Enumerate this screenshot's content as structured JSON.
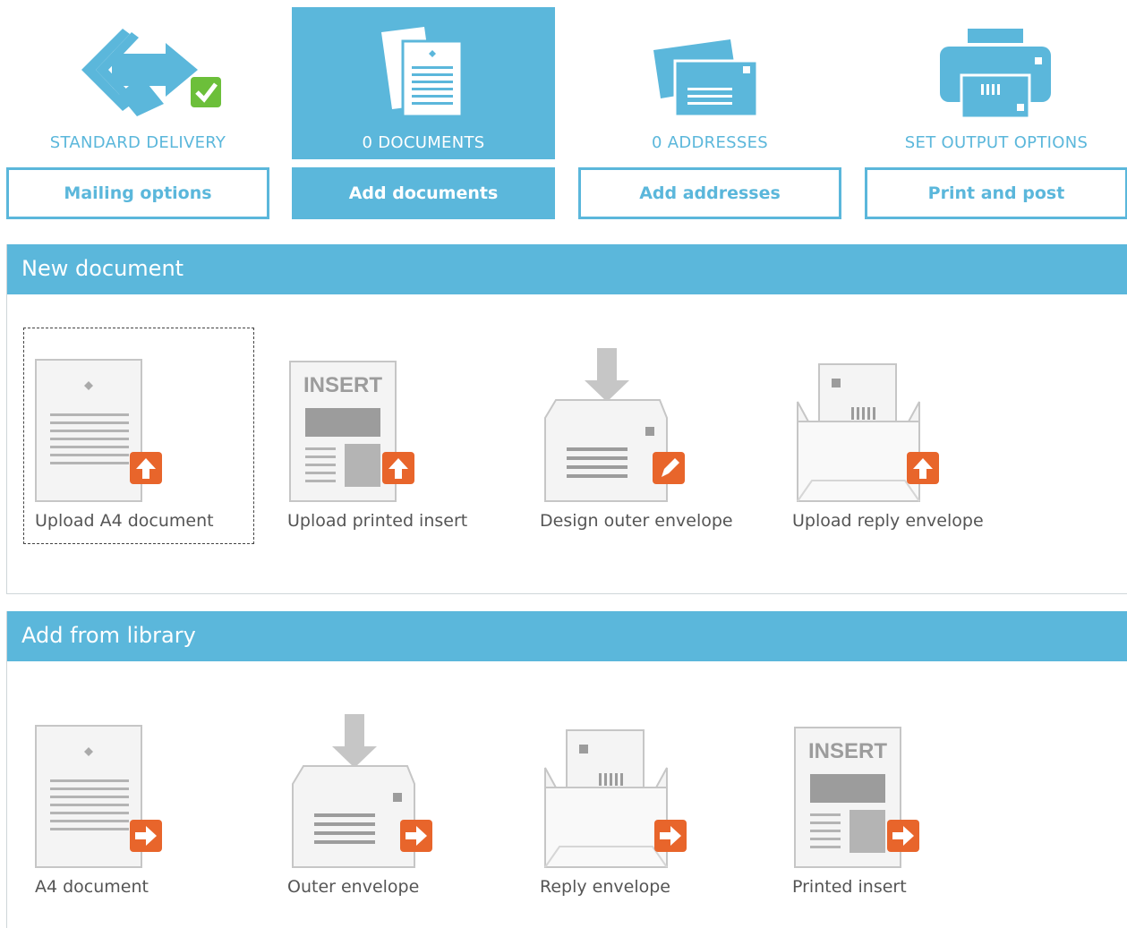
{
  "steps": [
    {
      "label": "STANDARD DELIVERY",
      "button": "Mailing options",
      "icon": "delivery-arrows-check-icon"
    },
    {
      "label": "0 DOCUMENTS",
      "button": "Add documents",
      "icon": "documents-stack-icon"
    },
    {
      "label": "0 ADDRESSES",
      "button": "Add addresses",
      "icon": "address-cards-icon"
    },
    {
      "label": "SET OUTPUT OPTIONS",
      "button": "Print and post",
      "icon": "printer-icon"
    }
  ],
  "new_document": {
    "title": "New document",
    "tiles": [
      {
        "label": "Upload A4 document",
        "icon": "a4-document-upload-icon"
      },
      {
        "label": "Upload printed insert",
        "icon": "printed-insert-upload-icon"
      },
      {
        "label": "Design outer envelope",
        "icon": "outer-envelope-edit-icon"
      },
      {
        "label": "Upload reply envelope",
        "icon": "reply-envelope-upload-icon"
      }
    ]
  },
  "library": {
    "title": "Add from library",
    "tiles": [
      {
        "label": "A4 document",
        "icon": "a4-document-add-icon"
      },
      {
        "label": "Outer envelope",
        "icon": "outer-envelope-add-icon"
      },
      {
        "label": "Reply envelope",
        "icon": "reply-envelope-add-icon"
      },
      {
        "label": "Printed insert",
        "icon": "printed-insert-add-icon"
      }
    ]
  },
  "insert_icon_text": "INSERT",
  "colors": {
    "accent": "#5bb7db",
    "badge": "#e8652b",
    "check": "#6cbf3a"
  }
}
